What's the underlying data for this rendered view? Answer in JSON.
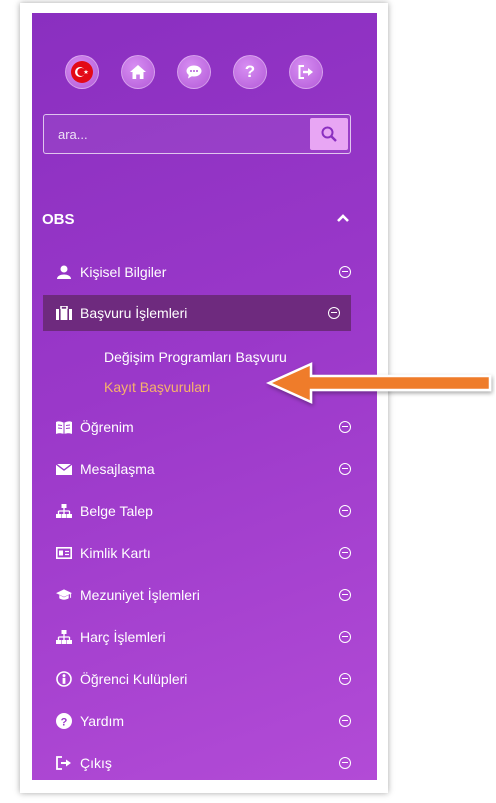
{
  "top_icons": [
    {
      "name": "turkey-flag-icon"
    },
    {
      "name": "home-icon"
    },
    {
      "name": "chat-icon"
    },
    {
      "name": "help-icon",
      "glyph": "?"
    },
    {
      "name": "logout-icon"
    }
  ],
  "search": {
    "placeholder": "ara..."
  },
  "section": {
    "title": "OBS"
  },
  "menu": [
    {
      "label": "Kişisel Bilgiler"
    },
    {
      "label": "Başvuru İşlemleri"
    },
    {
      "label": "Öğrenim"
    },
    {
      "label": "Mesajlaşma"
    },
    {
      "label": "Belge Talep"
    },
    {
      "label": "Kimlik Kartı"
    },
    {
      "label": "Mezuniyet İşlemleri"
    },
    {
      "label": "Harç İşlemleri"
    },
    {
      "label": "Öğrenci Kulüpleri"
    },
    {
      "label": "Yardım"
    },
    {
      "label": "Çıkış"
    }
  ],
  "submenu": [
    {
      "label": "Değişim Programları Başvuru"
    },
    {
      "label": "Kayıt Başvuruları"
    }
  ],
  "colors": {
    "sidebar": "#9a38c9",
    "active_item": "#6e2a7e",
    "highlight_text": "#f7b36a",
    "arrow": "#ef7b2c"
  }
}
